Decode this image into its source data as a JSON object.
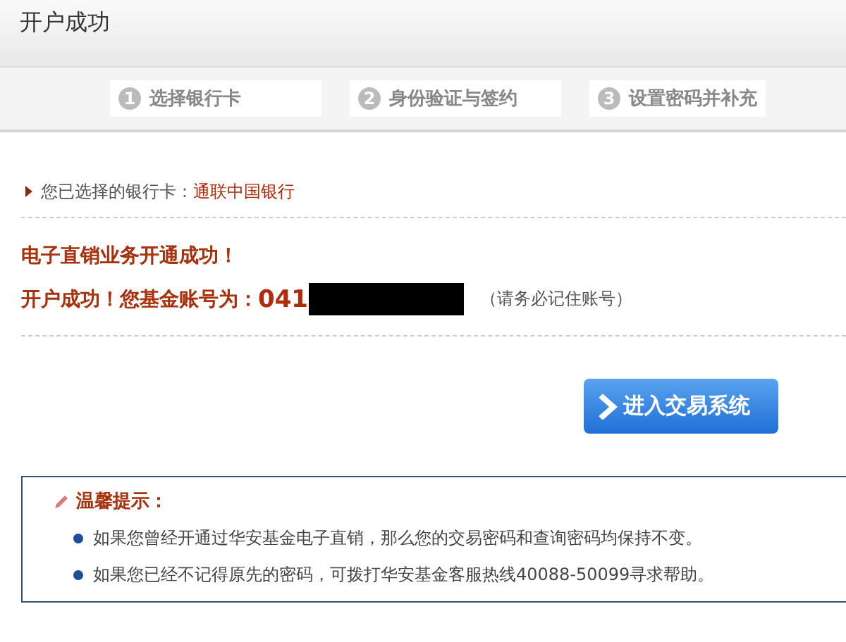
{
  "title": "开户成功",
  "steps": [
    {
      "number": "1",
      "label": "选择银行卡"
    },
    {
      "number": "2",
      "label": "身份验证与签约"
    },
    {
      "number": "3",
      "label": "设置密码并补充"
    }
  ],
  "bank": {
    "label": "您已选择的银行卡：",
    "value": "通联中国银行"
  },
  "success": {
    "headline": "电子直销业务开通成功！",
    "account_label": "开户成功！您基金账号为：",
    "account_prefix": "041",
    "note": "（请务必记住账号）"
  },
  "enter_button": "进入交易系统",
  "tips": {
    "title": "温馨提示：",
    "items": [
      "如果您曾经开通过华安基金电子直销，那么您的交易密码和查询密码均保持不变。",
      "如果您已经不记得原先的密码，可拨打华安基金客服热线40088-50099寻求帮助。"
    ]
  }
}
